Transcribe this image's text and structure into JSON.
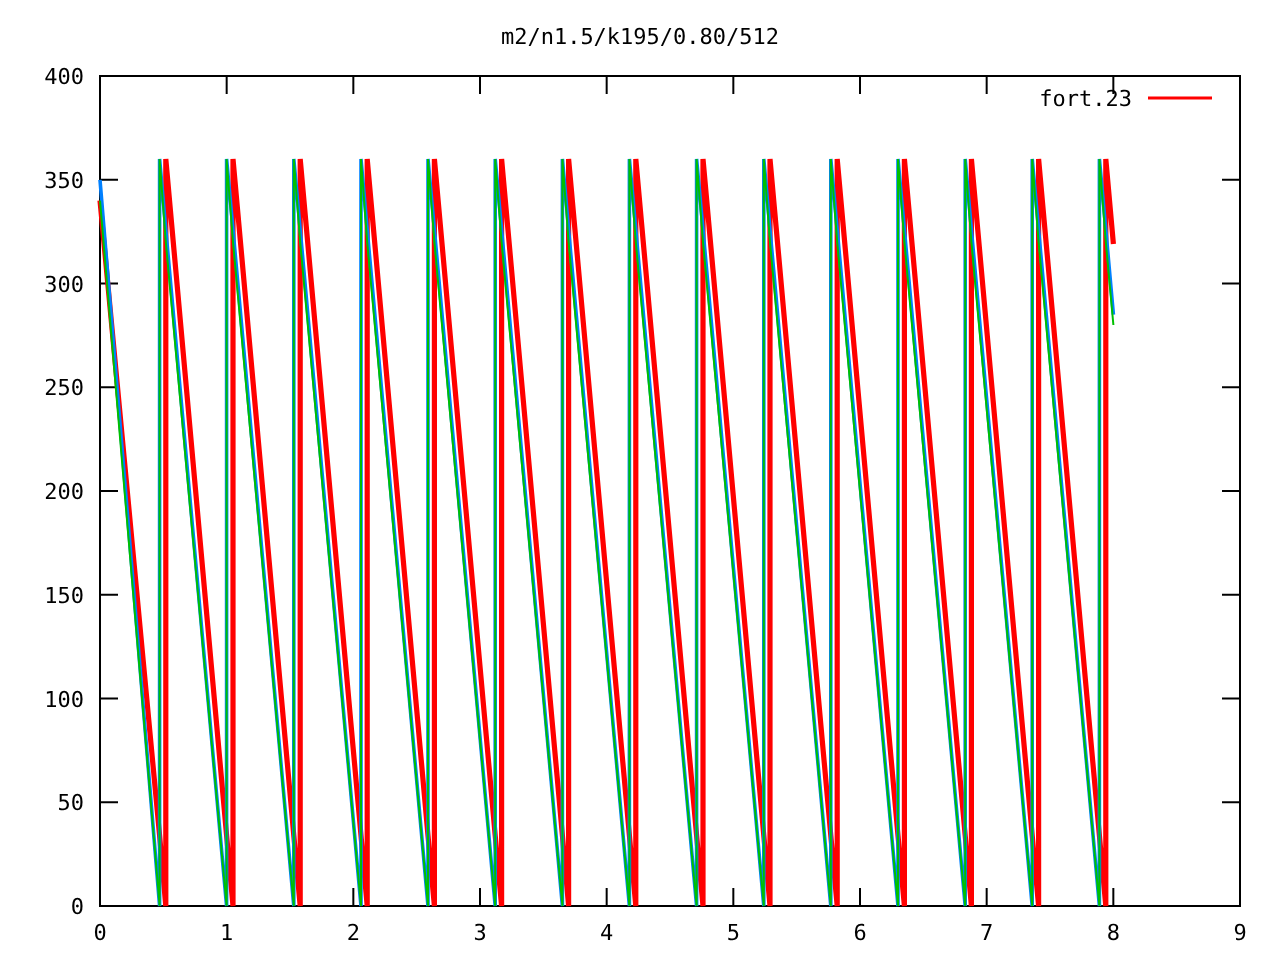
{
  "chart": {
    "chart_data": {
      "type": "line",
      "title": "m2/n1.5/k195/0.80/512",
      "xlim": [
        0,
        9
      ],
      "ylim": [
        0,
        400
      ],
      "xticks": [
        0,
        1,
        2,
        3,
        4,
        5,
        6,
        7,
        8,
        9
      ],
      "yticks": [
        0,
        50,
        100,
        150,
        200,
        250,
        300,
        350,
        400
      ],
      "x": [
        0,
        0.47,
        0.47,
        0.52,
        0.52,
        1.0,
        1.0,
        1.05,
        1.05,
        1.53,
        1.53,
        1.58,
        1.58,
        2.06,
        2.06,
        2.11,
        2.11,
        2.59,
        2.59,
        2.64,
        2.64,
        3.12,
        3.12,
        3.17,
        3.17,
        3.65,
        3.65,
        3.7,
        3.7,
        4.18,
        4.18,
        4.23,
        4.23,
        4.71,
        4.71,
        4.76,
        4.76,
        5.24,
        5.24,
        5.29,
        5.29,
        5.77,
        5.77,
        5.82,
        5.82,
        6.3,
        6.3,
        6.35,
        6.35,
        6.83,
        6.83,
        6.88,
        6.88,
        7.36,
        7.36,
        7.41,
        7.41,
        7.89,
        7.89,
        7.94,
        7.94,
        8.0
      ],
      "series": [
        {
          "name": "fort.23",
          "color": "#ff0000",
          "values": [
            340,
            34,
            34,
            0,
            360,
            34,
            34,
            0,
            360,
            34,
            34,
            0,
            360,
            34,
            34,
            0,
            360,
            34,
            34,
            0,
            360,
            34,
            34,
            0,
            360,
            34,
            34,
            0,
            360,
            34,
            34,
            0,
            360,
            34,
            34,
            0,
            360,
            34,
            34,
            0,
            360,
            34,
            34,
            0,
            360,
            34,
            34,
            0,
            360,
            34,
            34,
            0,
            360,
            34,
            34,
            0,
            360,
            34,
            34,
            0,
            360,
            319
          ]
        },
        {
          "color": "#0080ff",
          "values": [
            350,
            0,
            360,
            326,
            326,
            0,
            360,
            326,
            326,
            0,
            360,
            326,
            326,
            0,
            360,
            326,
            326,
            0,
            360,
            326,
            326,
            0,
            360,
            326,
            326,
            0,
            360,
            326,
            326,
            0,
            360,
            326,
            326,
            0,
            360,
            326,
            326,
            0,
            360,
            326,
            326,
            0,
            360,
            326,
            326,
            0,
            360,
            326,
            326,
            0,
            360,
            326,
            326,
            0,
            360,
            326,
            326,
            0,
            360,
            326,
            326,
            285
          ]
        },
        {
          "color": "#00c000",
          "values": [
            340,
            0,
            360,
            320,
            320,
            0,
            360,
            320,
            320,
            0,
            360,
            320,
            320,
            0,
            360,
            320,
            320,
            0,
            360,
            320,
            320,
            0,
            360,
            320,
            320,
            0,
            360,
            320,
            320,
            0,
            360,
            320,
            320,
            0,
            360,
            320,
            320,
            0,
            360,
            320,
            320,
            0,
            360,
            320,
            320,
            0,
            360,
            320,
            320,
            0,
            360,
            320,
            320,
            0,
            360,
            320,
            320,
            0,
            360,
            320,
            320,
            280
          ]
        }
      ]
    }
  }
}
